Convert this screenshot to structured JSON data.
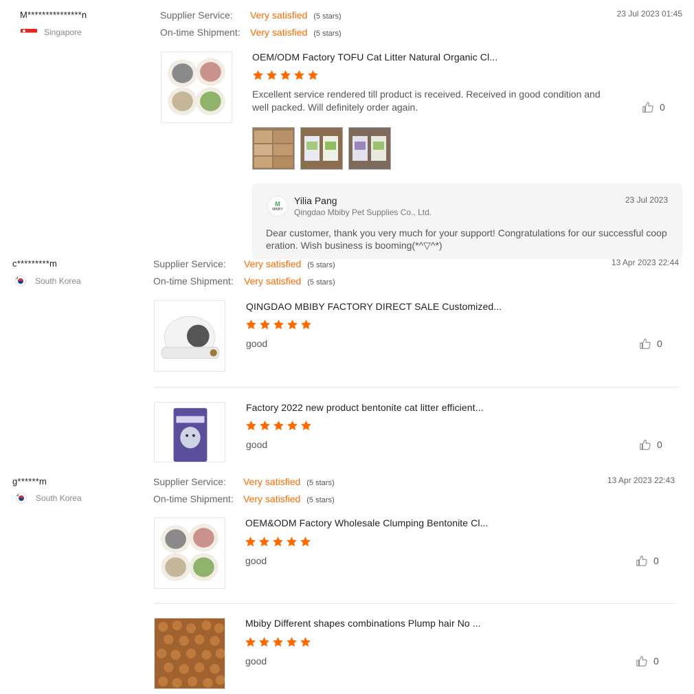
{
  "reviews": [
    {
      "name": "M***************n",
      "country": "Singapore",
      "supplier_label": "Supplier Service:",
      "supplier_value": "Very satisfied",
      "supplier_stars": "(5 stars)",
      "shipment_label": "On-time Shipment:",
      "shipment_value": "Very satisfied",
      "shipment_stars": "(5 stars)",
      "date": "23 Jul 2023 01:45",
      "items": [
        {
          "title": "OEM/ODM Factory TOFU Cat Litter Natural Organic Cl...",
          "rating": 5,
          "text": "Excellent service rendered till product is received. Received in good condition and well packed. Will definitely order again.",
          "likes": "0"
        }
      ],
      "reply": {
        "logo_text": "MBIBY",
        "name": "Yilia Pang",
        "company": "Qingdao Mbiby Pet Supplies Co., Ltd.",
        "date": "23 Jul 2023",
        "text": "Dear customer, thank you very much for your support! Congratulations for our successful cooperation. Wish business is booming(*^▽^*)"
      }
    },
    {
      "name": "c*********m",
      "country": "South Korea",
      "supplier_label": "Supplier Service:",
      "supplier_value": "Very satisfied",
      "supplier_stars": "(5 stars)",
      "shipment_label": "On-time Shipment:",
      "shipment_value": "Very satisfied",
      "shipment_stars": "(5 stars)",
      "date": "13 Apr 2023 22:44",
      "items": [
        {
          "title": "QINGDAO MBIBY FACTORY DIRECT SALE Customized...",
          "rating": 5,
          "text": "good",
          "likes": "0"
        },
        {
          "title": "Factory 2022 new product bentonite cat litter efficient...",
          "rating": 5,
          "text": "good",
          "likes": "0"
        }
      ]
    },
    {
      "name": "g******m",
      "country": "South Korea",
      "supplier_label": "Supplier Service:",
      "supplier_value": "Very satisfied",
      "supplier_stars": "(5 stars)",
      "shipment_label": "On-time Shipment:",
      "shipment_value": "Very satisfied",
      "shipment_stars": "(5 stars)",
      "date": "13 Apr 2023 22:43",
      "items": [
        {
          "title": "OEM&ODM Factory Wholesale Clumping Bentonite Cl...",
          "rating": 5,
          "text": "good",
          "likes": "0"
        },
        {
          "title": "Mbiby Different shapes combinations Plump hair No ...",
          "rating": 5,
          "text": "good",
          "likes": "0"
        }
      ]
    }
  ],
  "colors": {
    "accent": "#ff6a00",
    "star": "#ff6a00"
  },
  "icons": {
    "like": "thumbs-up-icon",
    "star": "star-icon"
  }
}
